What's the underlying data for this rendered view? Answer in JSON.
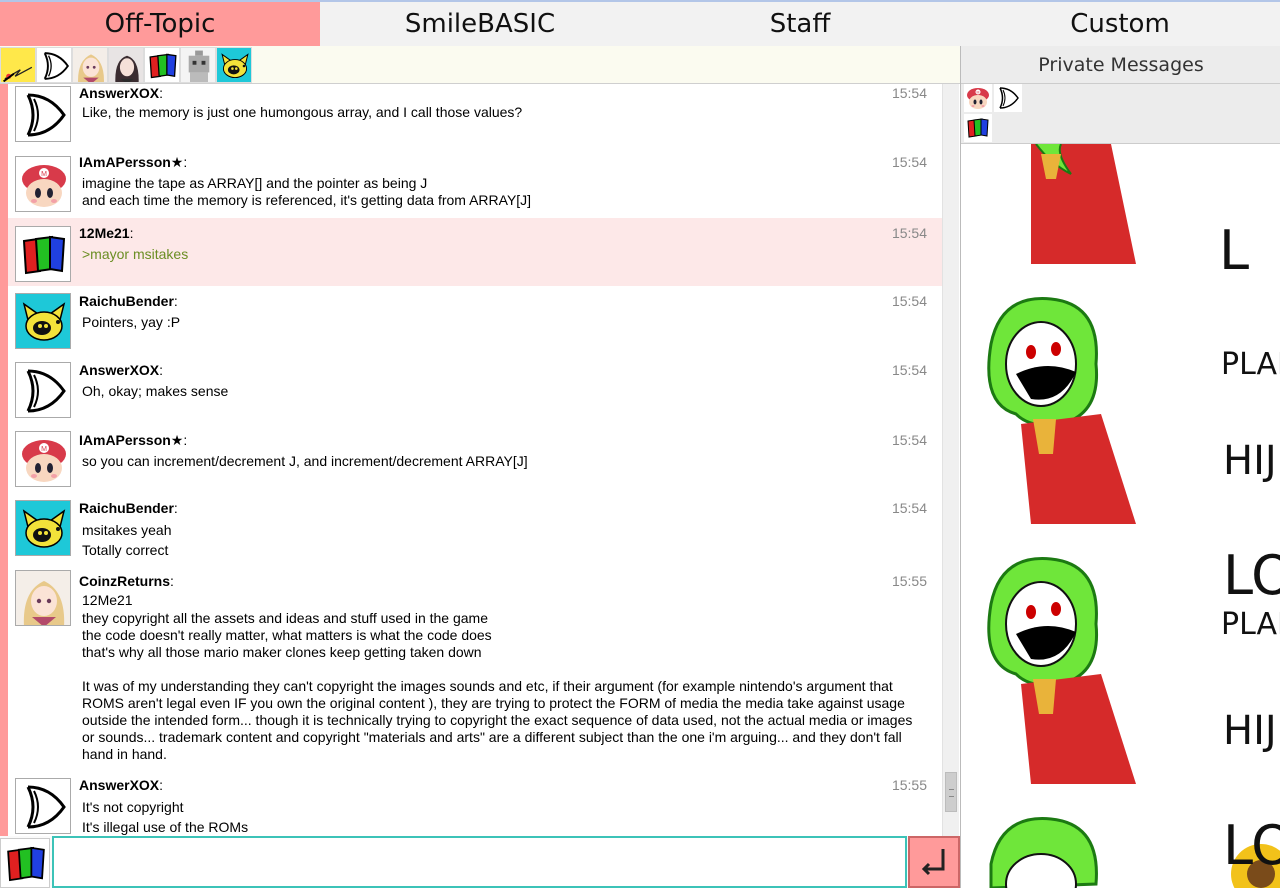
{
  "tabs": [
    {
      "label": "Off-Topic",
      "active": true
    },
    {
      "label": "SmileBASIC",
      "active": false
    },
    {
      "label": "Staff",
      "active": false
    },
    {
      "label": "Custom",
      "active": false
    }
  ],
  "userbar": {
    "avatars": [
      "pikachu-avatar",
      "or-gate-avatar",
      "anime-girl-avatar",
      "dark-girl-avatar",
      "rgb-blocks-avatar",
      "robot-avatar",
      "raichu-avatar"
    ]
  },
  "messages": [
    {
      "user": "AnswerXOX",
      "time": "15:54",
      "avatar": "or-gate-avatar",
      "lines": [
        "Like, the memory is just one humongous array, and I call those values?"
      ]
    },
    {
      "user": "IAmAPersson★",
      "time": "15:54",
      "avatar": "mario-avatar",
      "lines": [
        "imagine the tape as ARRAY[] and the pointer as being J",
        "and each time the memory is referenced, it's getting data from ARRAY[J]"
      ]
    },
    {
      "user": "12Me21",
      "time": "15:54",
      "avatar": "rgb-blocks-avatar",
      "highlight": true,
      "lines": [
        ">mayor msitakes"
      ]
    },
    {
      "user": "RaichuBender",
      "time": "15:54",
      "avatar": "raichu-avatar",
      "lines": [
        "Pointers, yay :P"
      ]
    },
    {
      "user": "AnswerXOX",
      "time": "15:54",
      "avatar": "or-gate-avatar",
      "lines": [
        "Oh, okay; makes sense"
      ]
    },
    {
      "user": "IAmAPersson★",
      "time": "15:54",
      "avatar": "mario-avatar",
      "lines": [
        "so you can increment/decrement J, and increment/decrement ARRAY[J]"
      ]
    },
    {
      "user": "RaichuBender",
      "time": "15:54",
      "avatar": "raichu-avatar",
      "lines": [
        "msitakes yeah",
        "Totally correct"
      ]
    },
    {
      "user": "CoinzReturns",
      "time": "15:55",
      "avatar": "anime-girl-avatar",
      "lines": [
        "12Me21",
        "they copyright all the assets and ideas and stuff used in the game\nthe code doesn't really matter, what matters is what the code does\nthat's why all those mario maker clones keep getting taken down\n\nIt was of my understanding they can't copyright the images sounds and etc, if their argument (for example nintendo's argument that ROMS aren't legal even IF you own the original content ), they are trying to protect the FORM of media the media take against usage outside the intended form... though it is technically trying to copyright the exact sequence of data used, not the actual media or images or sounds... trademark content and copyright \"materials and arts\" are a different subject than the one i'm arguing... and they don't fall hand in hand."
      ]
    },
    {
      "user": "AnswerXOX",
      "time": "15:55",
      "avatar": "or-gate-avatar",
      "lines": [
        "It's not copyright",
        "It's illegal use of the ROMs"
      ]
    }
  ],
  "input": {
    "value": "",
    "placeholder": ""
  },
  "send_button": {
    "icon": "return-arrow-icon"
  },
  "right_panel": {
    "title": "Private Messages",
    "pm_avatars": [
      "mario-avatar",
      "or-gate-avatar",
      "rgb-blocks-avatar"
    ],
    "background_text": [
      "PLAN",
      "HIJ",
      "LO"
    ]
  },
  "colors": {
    "accent": "#ff9a9a",
    "highlight": "#fde8e8",
    "quote": "#6b8e23",
    "input_border": "#3cc3b8"
  }
}
